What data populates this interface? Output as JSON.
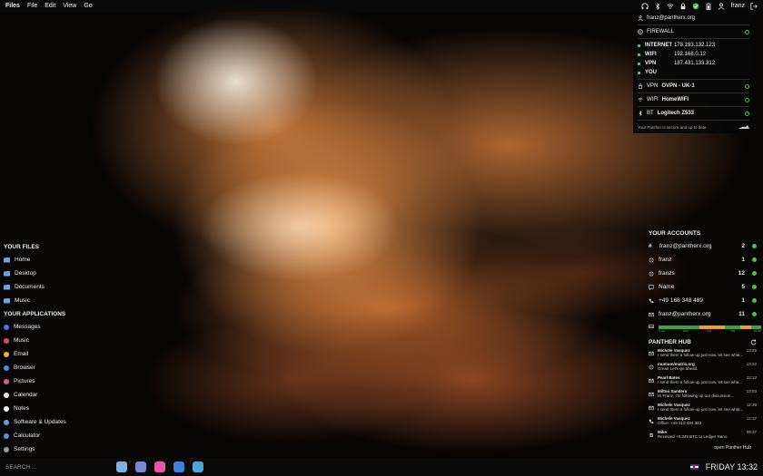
{
  "topbar": {
    "app": "Files",
    "menu": [
      "File",
      "Edit",
      "View",
      "Go"
    ],
    "user": "franz"
  },
  "security": {
    "account": "franz@pantherx.org",
    "firewall_label": "FIREWALL",
    "network": [
      {
        "key": "INTERNET",
        "value": "178.193.132.123"
      },
      {
        "key": "WIFI",
        "value": "192.168.0.12"
      },
      {
        "key": "VPN",
        "value": "187.431.133.312"
      },
      {
        "key": "YOU",
        "value": ""
      }
    ],
    "vpn_label": "VPN",
    "vpn_value": "OVPN - UK-1",
    "wifi_label": "WIFI",
    "wifi_value": "HomeWIFI",
    "bt_label": "BT",
    "bt_value": "Logitech Z533",
    "secure_text": "Your Panther is secure and up to date."
  },
  "accounts": {
    "title": "YOUR ACCOUNTS",
    "items": [
      {
        "icon": "hash-icon",
        "label": "franz@pantherx.org",
        "count": "2"
      },
      {
        "icon": "matrix-icon",
        "label": "franz",
        "count": "1"
      },
      {
        "icon": "matrix-icon",
        "label": "franzs",
        "count": "12"
      },
      {
        "icon": "chat-icon",
        "label": "Name",
        "count": "5"
      },
      {
        "icon": "phone-icon",
        "label": "+49 168 348 489",
        "count": "1"
      },
      {
        "icon": "mail-icon",
        "label": "franz@pantherx.org",
        "count": "11"
      }
    ],
    "storage_ticks": [
      "0.12",
      "u24",
      "+44",
      "+56",
      "14.59"
    ]
  },
  "hub": {
    "title": "PANTHER HUB",
    "messages": [
      {
        "icon": "mail-icon",
        "sender": "Michele Vasquez",
        "time": "13:25",
        "text": "I send them a follow-up just now, let see what..."
      },
      {
        "icon": "matrix-icon",
        "sender": "mumum/matrix.org",
        "time": "13:22",
        "text": "Great! Let's go ahead."
      },
      {
        "icon": "mail-icon",
        "sender": "Pearl Bates",
        "time": "13:12",
        "text": "I send them a follow-up just now, let see wha..."
      },
      {
        "icon": "mail-icon",
        "sender": "Milton Sanders",
        "time": "13:03",
        "text": "Hi Franz, I'm following up our discussion..."
      },
      {
        "icon": "mail-icon",
        "sender": "Michele Vasquez",
        "time": "12:38",
        "text": "I send them a follow-up just now, let see what..."
      },
      {
        "icon": "phone-icon",
        "sender": "Michele Vasquez",
        "time": "12:37",
        "text": "Office: +49 310 484 333"
      },
      {
        "icon": "bitcoin-icon",
        "sender": "Mike",
        "time": "09:37",
        "text": "Received +0.349 BTC to Ledger Nano"
      }
    ],
    "open_label": "open Panther Hub"
  },
  "files": {
    "title": "YOUR FILES",
    "items": [
      "Home",
      "Desktop",
      "Documents",
      "Music"
    ]
  },
  "apps": {
    "title": "YOUR APPLICATIONS",
    "items": [
      {
        "label": "Messages",
        "color": "#3d7be0"
      },
      {
        "label": "Music",
        "color": "#e04a6a"
      },
      {
        "label": "Email",
        "color": "#f0b12e"
      },
      {
        "label": "Browser",
        "color": "#4a8ee0"
      },
      {
        "label": "Pictures",
        "color": "#d95a8c"
      },
      {
        "label": "Calendar",
        "color": "#e8e8e8"
      },
      {
        "label": "Notes",
        "color": "#f2f2f2"
      },
      {
        "label": "Software & Updates",
        "color": "#5aa0e8"
      },
      {
        "label": "Calculator",
        "color": "#5a8ed8"
      },
      {
        "label": "Settings",
        "color": "#9a9a9a"
      }
    ]
  },
  "bottombar": {
    "search_placeholder": "SEARCH ...",
    "dock": [
      {
        "name": "files-icon",
        "color": "#7fb0e0"
      },
      {
        "name": "browser-icon",
        "color": "#7a86d8"
      },
      {
        "name": "music-icon",
        "color": "#e855a0"
      },
      {
        "name": "software-icon",
        "color": "#3f7fe0"
      },
      {
        "name": "settings-icon",
        "color": "#4aa8d8"
      }
    ],
    "clock": "FRIDAY 13:32"
  }
}
